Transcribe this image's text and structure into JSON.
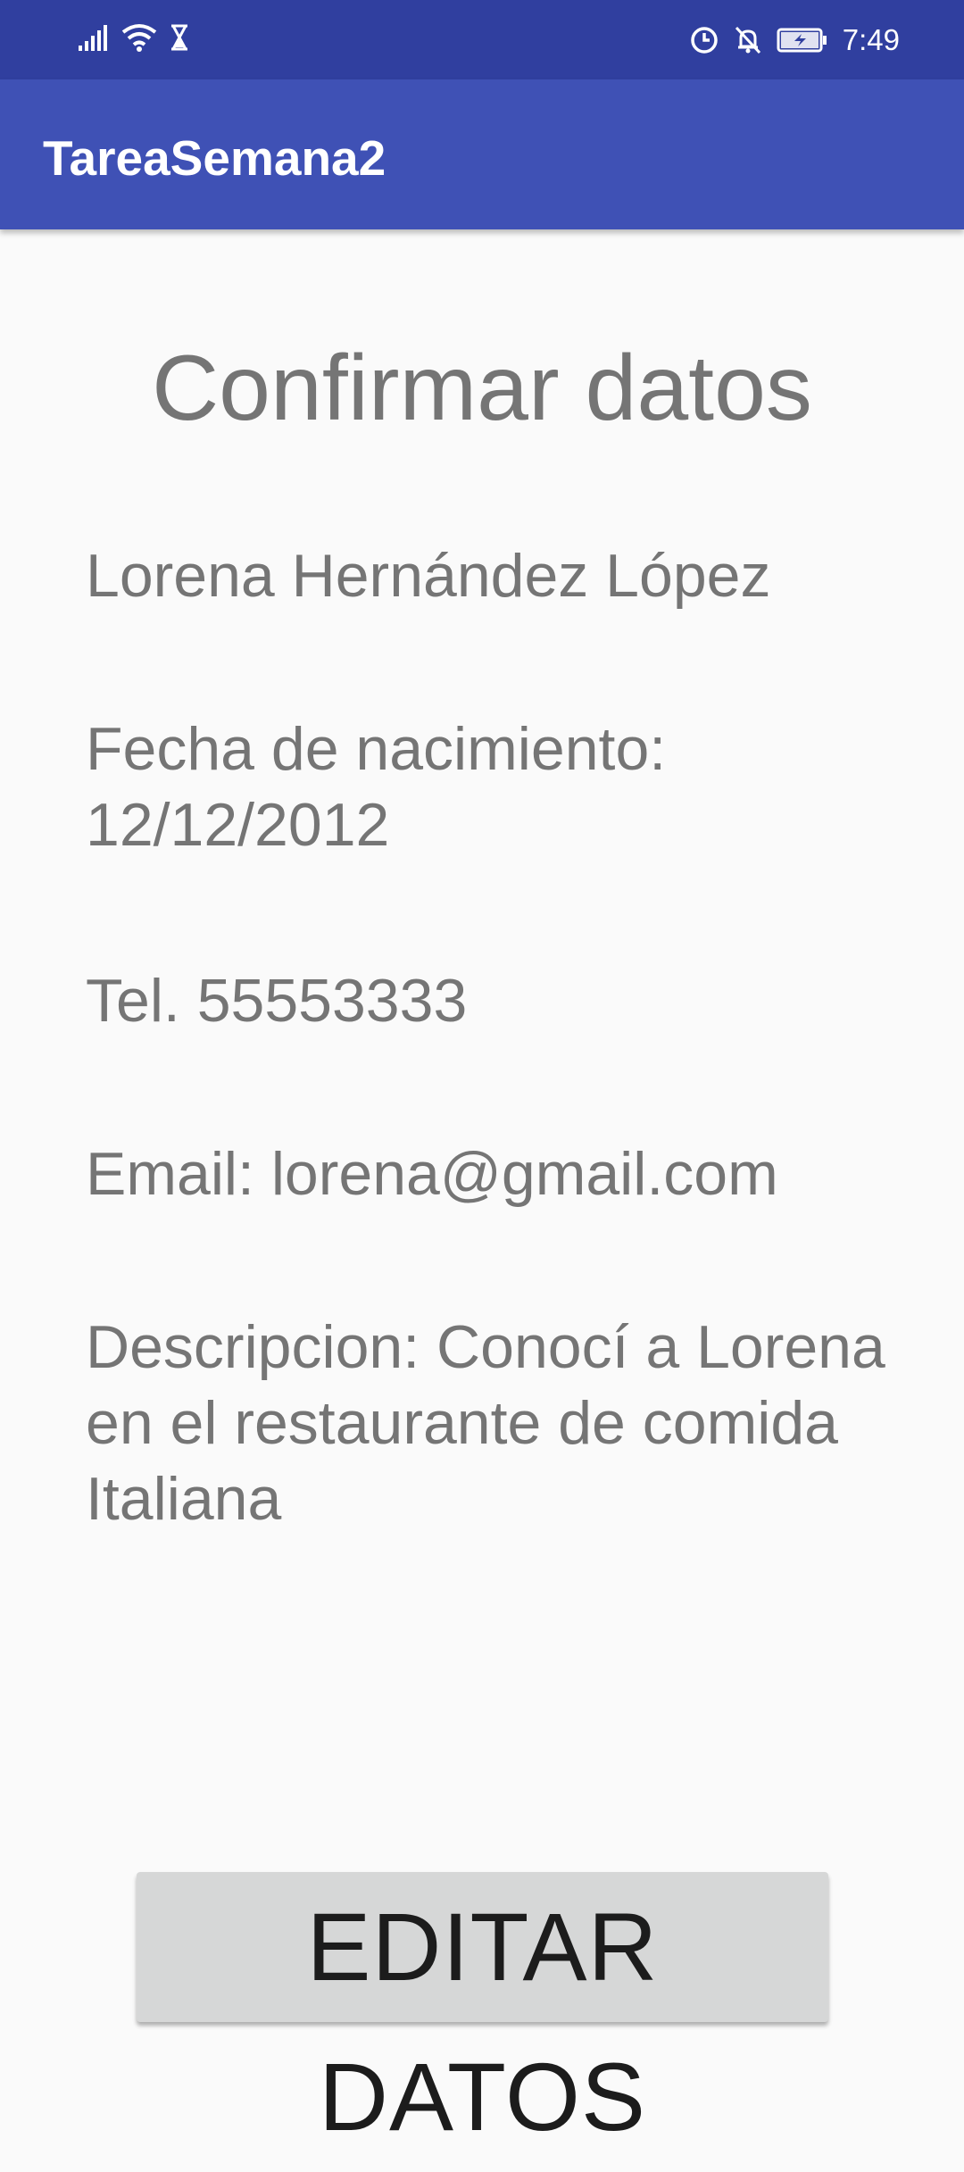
{
  "status_bar": {
    "time": "7:49",
    "left_icons": [
      "signal-icon",
      "wifi-icon",
      "hourglass-icon"
    ],
    "right_icons": [
      "data-saver-icon",
      "notifications-off-icon",
      "battery-charging-icon"
    ],
    "background": "#303f9f"
  },
  "app_bar": {
    "title": "TareaSemana2",
    "background": "#3f51b5"
  },
  "main": {
    "heading": "Confirmar datos",
    "name": "Lorena Hernández López",
    "birth_label": "Fecha de nacimiento:",
    "birth_date": "12/12/2012",
    "phone": "Tel. 55553333",
    "email": "Email: lorena@gmail.com",
    "description": "Descripcion: Conocí a Lorena en el restaurante de comida Italiana",
    "text_color": "#757575"
  },
  "actions": {
    "edit_label": "EDITAR DATOS",
    "button_color": "#d6d7d7"
  }
}
